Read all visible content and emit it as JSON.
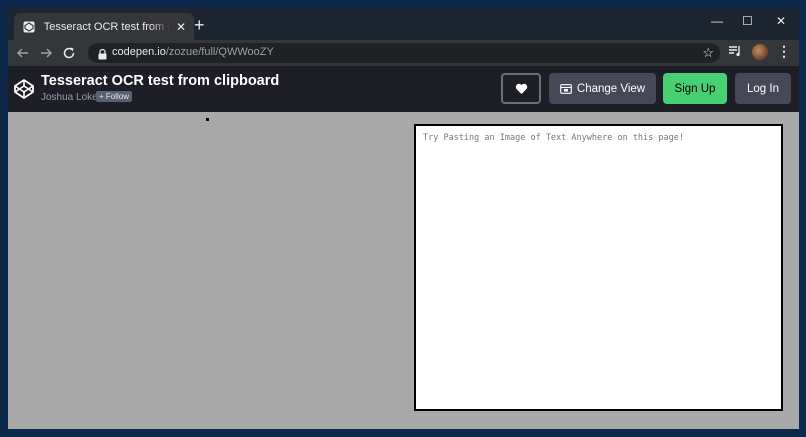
{
  "browser": {
    "tab": {
      "title": "Tesseract OCR test from clipboard",
      "close_glyph": "✕"
    },
    "new_tab_glyph": "+",
    "window_controls": {
      "minimize": "—",
      "maximize": "☐",
      "close": "✕"
    },
    "url": {
      "host": "codepen.io",
      "path": "/zozue/full/QWWooZY"
    },
    "icons": [
      "back-arrow-icon",
      "forward-arrow-icon",
      "reload-icon",
      "lock-icon",
      "bookmark-star-icon",
      "media-list-icon",
      "profile-avatar",
      "more-menu-icon"
    ],
    "star_glyph": "☆",
    "menu_glyph": "⋮"
  },
  "codepen": {
    "title": "Tesseract OCR test from clipboard",
    "author": "Joshua Loke",
    "follow_label": "+ Follow",
    "change_view_label": "Change View",
    "signup_label": "Sign Up",
    "login_label": "Log In",
    "colors": {
      "header_bg": "#1e1f26",
      "signup_green": "#47cf73",
      "button_gray": "#444857"
    }
  },
  "page": {
    "placeholder": "Try Pasting an Image of Text Anywhere on this page!",
    "background": "#a9a9a9"
  }
}
